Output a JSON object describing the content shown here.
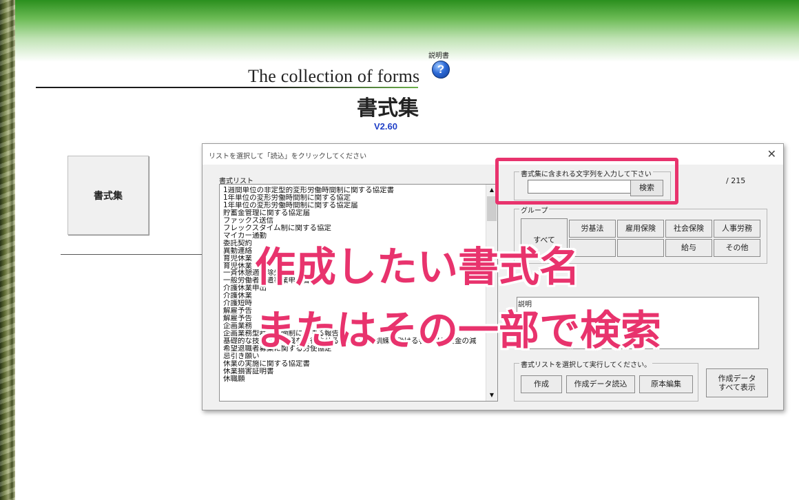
{
  "header": {
    "title_en": "The collection of forms",
    "title_jp": "書式集",
    "version": "V2.60",
    "manual_label": "説明書",
    "help_glyph": "?"
  },
  "main": {
    "forms_button_label": "書式集"
  },
  "dialog": {
    "title": "リストを選択して「読込」をクリックしてください",
    "close_glyph": "✕",
    "list_label": "書式リスト",
    "list_items": [
      "1週間単位の非定型的変形労働時間制に関する協定書",
      "1年単位の変形労働時間制に関する協定",
      "1年単位の変形労働時間制に関する協定届",
      "貯蓄金管理に関する協定届",
      "ファックス送信",
      "フレックスタイム制に関する協定",
      "マイカー通勤",
      "委託契約",
      "異動連絡",
      "育児休業",
      "育児休業",
      "一斉休憩適用除外",
      "一般労働者派遣事業申請書",
      "介護休業申出",
      "介護休業",
      "介護短時",
      "解雇予告",
      "解雇予告",
      "企画業務",
      "企画業務型裁量労働制に関する報告",
      "基礎的な技能及び知識を習得させるための職業訓練を受ける者の最低賃金の減",
      "希望退職者募集に関する労使協定",
      "忌引き願い",
      "休業の実施に関する協定書",
      "休業損害証明書",
      "休職願"
    ],
    "search": {
      "legend": "書式集に含まれる文字列を入力して下さい",
      "value": "",
      "button_label": "検索"
    },
    "count": "/ 215",
    "group": {
      "legend": "グループ",
      "all_label": "すべて",
      "buttons_row1": [
        "労基法",
        "雇用保険",
        "社会保険",
        "人事労務"
      ],
      "buttons_row2": [
        "",
        "",
        "給与",
        "その他"
      ]
    },
    "description_label": "説明",
    "execute": {
      "legend": "書式リストを選択して実行してください。",
      "create_label": "作成",
      "load_label": "作成データ読込",
      "edit_label": "原本編集"
    },
    "show_all_label_line1": "作成データ",
    "show_all_label_line2": "すべて表示"
  },
  "overlay": {
    "line1": "作成したい書式名",
    "line2": "またはその一部で検索"
  },
  "colors": {
    "accent_pink": "#e8336d",
    "version_blue": "#1f3fc7",
    "banner_green": "#2b8f1e"
  }
}
